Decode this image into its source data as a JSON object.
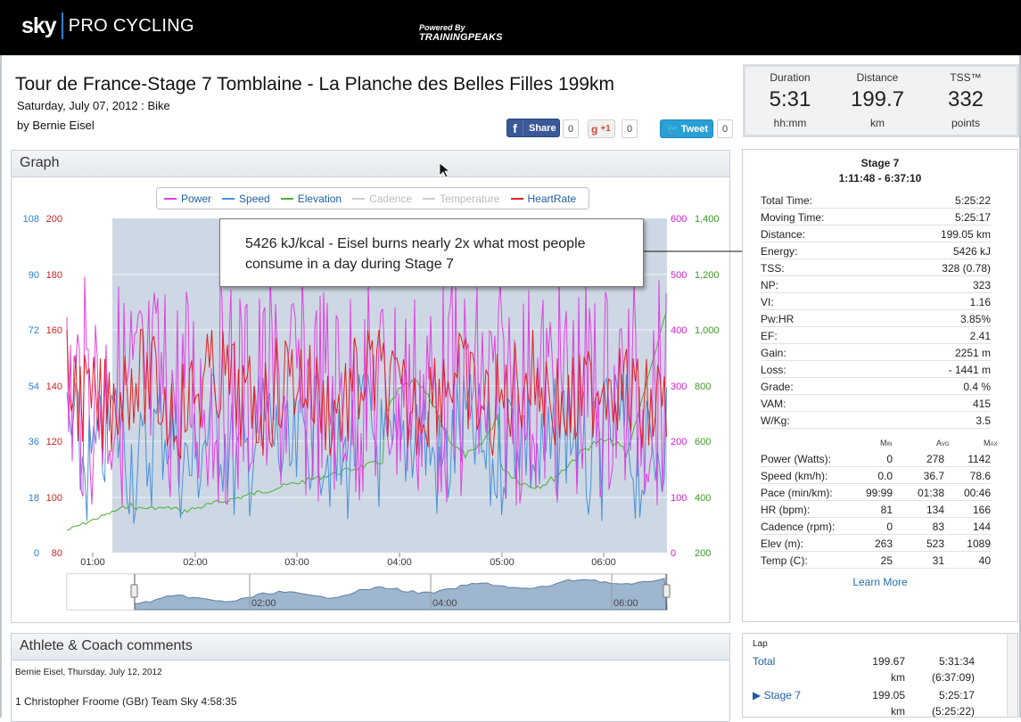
{
  "header": {
    "logo_sky": "sky",
    "logo_pro": "PRO CYCLING",
    "powered_line1": "Powered By",
    "powered_line2": "TRAININGPEAKS"
  },
  "workout": {
    "title": "Tour de France-Stage 7 Tomblaine - La Planche des Belles Filles 199km",
    "date": "Saturday, July 07, 2012 : Bike",
    "author": "by Bernie Eisel"
  },
  "social": {
    "facebook_label": "Share",
    "facebook_count": "0",
    "gplus_label": "+1",
    "gplus_count": "0",
    "twitter_label": "Tweet",
    "twitter_count": "0"
  },
  "summary": {
    "duration": {
      "label": "Duration",
      "value": "5:31",
      "unit": "hh:mm"
    },
    "distance": {
      "label": "Distance",
      "value": "199.7",
      "unit": "km"
    },
    "tss": {
      "label": "TSS™",
      "value": "332",
      "unit": "points"
    }
  },
  "graph": {
    "title": "Graph",
    "legend": [
      {
        "label": "Power",
        "color": "#e040e0",
        "active": true
      },
      {
        "label": "Speed",
        "color": "#4a90d9",
        "active": true
      },
      {
        "label": "Elevation",
        "color": "#4caf33",
        "active": true
      },
      {
        "label": "Cadence",
        "color": "#cccccc",
        "active": false
      },
      {
        "label": "Temperature",
        "color": "#cccccc",
        "active": false
      },
      {
        "label": "HeartRate",
        "color": "#dd2222",
        "active": true
      }
    ],
    "annotation": "5426 kJ/kcal - Eisel burns nearly 2x what most people consume in a day during Stage 7",
    "speed_axis": [
      "108",
      "90",
      "72",
      "54",
      "36",
      "18",
      "0"
    ],
    "hr_axis": [
      "200",
      "180",
      "160",
      "140",
      "120",
      "100",
      "80"
    ],
    "power_axis": [
      "600",
      "500",
      "400",
      "300",
      "200",
      "100",
      "0"
    ],
    "elev_axis": [
      "1,400",
      "1,200",
      "1,000",
      "800",
      "600",
      "400",
      "200"
    ],
    "time_axis": [
      "01:00",
      "02:00",
      "03:00",
      "04:00",
      "05:00",
      "06:00"
    ],
    "nav_axis": [
      "02:00",
      "04:00",
      "06:00"
    ]
  },
  "stats": {
    "title": "Stage 7",
    "range": "1:11:48 - 6:37:10",
    "rows": [
      {
        "k": "Total Time:",
        "v": "5:25:22"
      },
      {
        "k": "Moving Time:",
        "v": "5:25:17"
      },
      {
        "k": "Distance:",
        "v": "199.05 km"
      },
      {
        "k": "Energy:",
        "v": "5426 kJ"
      },
      {
        "k": "TSS:",
        "v": "328 (0.78)"
      },
      {
        "k": "NP:",
        "v": "323"
      },
      {
        "k": "VI:",
        "v": "1.16"
      },
      {
        "k": "Pw:HR",
        "v": "3.85%"
      },
      {
        "k": "EF:",
        "v": "2.41"
      },
      {
        "k": "Gain:",
        "v": "2251 m"
      },
      {
        "k": "Loss:",
        "v": "- 1441 m"
      },
      {
        "k": "Grade:",
        "v": "0.4 %"
      },
      {
        "k": "VAM:",
        "v": "415"
      },
      {
        "k": "W/Kg:",
        "v": "3.5"
      }
    ],
    "mm_headers": [
      "Min",
      "Avg",
      "Max"
    ],
    "mm_rows": [
      {
        "k": "Power (Watts):",
        "min": "0",
        "avg": "278",
        "max": "1142"
      },
      {
        "k": "Speed (km/h):",
        "min": "0.0",
        "avg": "36.7",
        "max": "78.6"
      },
      {
        "k": "Pace (min/km):",
        "min": "99:99",
        "avg": "01:38",
        "max": "00:46"
      },
      {
        "k": "HR (bpm):",
        "min": "81",
        "avg": "134",
        "max": "166"
      },
      {
        "k": "Cadence (rpm):",
        "min": "0",
        "avg": "83",
        "max": "144"
      },
      {
        "k": "Elev (m):",
        "min": "263",
        "avg": "523",
        "max": "1089"
      },
      {
        "k": "Temp (C):",
        "min": "25",
        "avg": "31",
        "max": "40"
      }
    ],
    "learn_more": "Learn More"
  },
  "comments": {
    "title": "Athlete & Coach comments",
    "byline": "Bernie Eisel, Thursday, July 12, 2012",
    "line1": "1 Christopher Froome (GBr) Team Sky 4:58:35"
  },
  "laps": {
    "header": "Lap",
    "rows": [
      {
        "name": "Total",
        "dist": "199.67",
        "unit": "km",
        "time": "5:31:34",
        "sub": "(6:37:09)"
      },
      {
        "name": "Stage 7",
        "dist": "199.05",
        "unit": "km",
        "time": "5:25:17",
        "sub": "(5:25:22)"
      }
    ]
  }
}
